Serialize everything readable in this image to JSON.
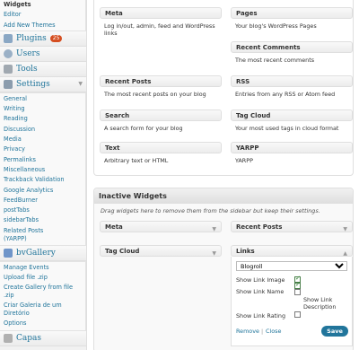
{
  "sidebar": {
    "appearance": {
      "items": [
        {
          "label": "Widgets",
          "current": true
        },
        {
          "label": "Editor"
        },
        {
          "label": "Add New Themes"
        }
      ]
    },
    "plugins": {
      "label": "Plugins",
      "badge": "25",
      "icon": "plug-icon"
    },
    "users": {
      "label": "Users",
      "icon": "users-icon"
    },
    "tools": {
      "label": "Tools",
      "icon": "tools-icon"
    },
    "settings": {
      "label": "Settings",
      "icon": "settings-icon",
      "items": [
        "General",
        "Writing",
        "Reading",
        "Discussion",
        "Media",
        "Privacy",
        "Permalinks",
        "Miscellaneous",
        "Trackback Validation",
        "Google Analytics",
        "FeedBurner",
        "postTabs",
        "sidebarTabs",
        "Related Posts (YARPP)"
      ]
    },
    "bvgallery": {
      "label": "bvGallery",
      "icon": "gallery-icon",
      "items": [
        "Manage Events",
        "Upload file .zip",
        "Create Gallery from file .zip",
        "Criar Galeria de um Diretório",
        "Options"
      ]
    },
    "capas": {
      "label": "Capas",
      "icon": "capas-icon"
    }
  },
  "available_widgets": [
    {
      "name": "Meta",
      "desc": "Log in/out, admin, feed and WordPress links"
    },
    {
      "name": "Pages",
      "desc": "Your blog's WordPress Pages"
    },
    {
      "name": "Recent Comments",
      "desc": "The most recent comments"
    },
    {
      "name": "Recent Posts",
      "desc": "The most recent posts on your blog"
    },
    {
      "name": "RSS",
      "desc": "Entries from any RSS or Atom feed"
    },
    {
      "name": "Search",
      "desc": "A search form for your blog"
    },
    {
      "name": "Tag Cloud",
      "desc": "Your most used tags in cloud format"
    },
    {
      "name": "Text",
      "desc": "Arbitrary text or HTML"
    },
    {
      "name": "YARPP",
      "desc": "YARPP"
    }
  ],
  "inactive": {
    "title": "Inactive Widgets",
    "hint": "Drag widgets here to remove them from the sidebar but keep their settings.",
    "widgets": [
      "Meta",
      "Recent Posts",
      "Tag Cloud",
      "Links"
    ],
    "links_form": {
      "category_value": "Blogroll",
      "show_link_image": "Show Link Image",
      "show_link_name": "Show Link Name",
      "show_link_description": "Show Link Description",
      "show_link_rating": "Show Link Rating",
      "remove": "Remove",
      "close": "Close",
      "separator": "|",
      "save": "Save"
    }
  },
  "colors": {
    "link": "#21759b",
    "badge": "#d54e21",
    "save": "#21759b"
  }
}
